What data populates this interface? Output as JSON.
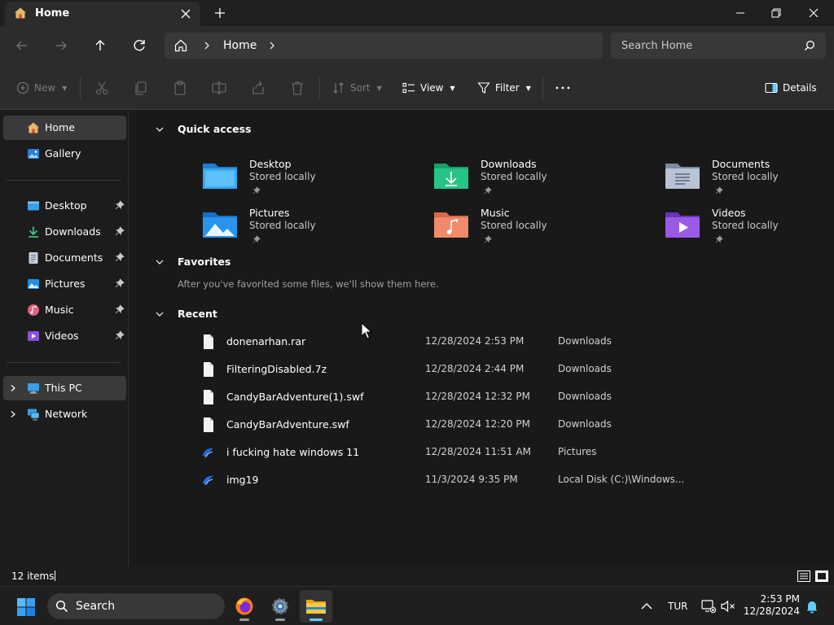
{
  "window": {
    "tab_title": "Home",
    "accent": "#60cdff"
  },
  "address": {
    "crumb": "Home",
    "search_placeholder": "Search Home"
  },
  "command_bar": {
    "new_label": "New",
    "sort_label": "Sort",
    "view_label": "View",
    "filter_label": "Filter",
    "details_label": "Details"
  },
  "sidebar": {
    "items": [
      {
        "label": "Home",
        "icon": "home-icon"
      },
      {
        "label": "Gallery",
        "icon": "gallery-icon"
      },
      {
        "label": "Desktop",
        "icon": "desktop-icon"
      },
      {
        "label": "Downloads",
        "icon": "downloads-icon"
      },
      {
        "label": "Documents",
        "icon": "documents-icon"
      },
      {
        "label": "Pictures",
        "icon": "pictures-icon"
      },
      {
        "label": "Music",
        "icon": "music-icon"
      },
      {
        "label": "Videos",
        "icon": "videos-icon"
      },
      {
        "label": "This PC",
        "icon": "this-pc-icon"
      },
      {
        "label": "Network",
        "icon": "network-icon"
      }
    ]
  },
  "main": {
    "quick_access": {
      "title": "Quick access",
      "tiles": [
        {
          "name": "Desktop",
          "sub": "Stored locally"
        },
        {
          "name": "Downloads",
          "sub": "Stored locally"
        },
        {
          "name": "Documents",
          "sub": "Stored locally"
        },
        {
          "name": "Pictures",
          "sub": "Stored locally"
        },
        {
          "name": "Music",
          "sub": "Stored locally"
        },
        {
          "name": "Videos",
          "sub": "Stored locally"
        }
      ]
    },
    "favorites": {
      "title": "Favorites",
      "empty_text": "After you've favorited some files, we'll show them here."
    },
    "recent": {
      "title": "Recent",
      "rows": [
        {
          "name": "donenarhan.rar",
          "date": "12/28/2024 2:53 PM",
          "location": "Downloads",
          "icon": "file-icon"
        },
        {
          "name": "FilteringDisabled.7z",
          "date": "12/28/2024 2:44 PM",
          "location": "Downloads",
          "icon": "file-icon"
        },
        {
          "name": "CandyBarAdventure(1).swf",
          "date": "12/28/2024 12:32 PM",
          "location": "Downloads",
          "icon": "file-icon"
        },
        {
          "name": "CandyBarAdventure.swf",
          "date": "12/28/2024 12:20 PM",
          "location": "Downloads",
          "icon": "file-icon"
        },
        {
          "name": "i fucking hate windows 11",
          "date": "12/28/2024 11:51 AM",
          "location": "Pictures",
          "icon": "image-file-icon"
        },
        {
          "name": "img19",
          "date": "11/3/2024 9:35 PM",
          "location": "Local Disk (C:)\\Windows...",
          "icon": "image-file-icon"
        }
      ]
    }
  },
  "status": {
    "item_count": "12 items"
  },
  "taskbar": {
    "search_label": "Search",
    "language": "TUR",
    "time": "2:53 PM",
    "date": "12/28/2024"
  }
}
